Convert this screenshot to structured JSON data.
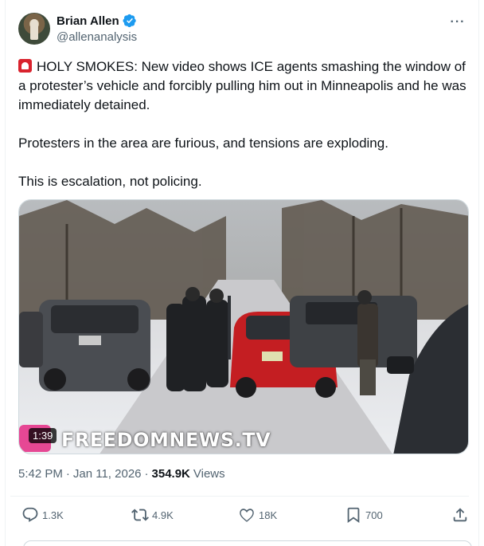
{
  "author": {
    "display_name": "Brian Allen",
    "handle": "@allenanalysis",
    "verified": true
  },
  "tweet": {
    "paragraphs": [
      "HOLY SMOKES: New video shows ICE agents smashing the window of a protester’s vehicle and forcibly pulling him out in Minneapolis and he was immediately detained.",
      "Protesters in the area are furious, and tensions are exploding.",
      "This is escalation, not policing."
    ],
    "emoji_icon": "rotating-light-icon"
  },
  "media": {
    "duration": "1:39",
    "watermark": "FREEDOMNEWS.TV"
  },
  "meta": {
    "time": "5:42 PM",
    "separator": "·",
    "date": "Jan 11, 2026",
    "views_count": "354.9K",
    "views_label": "Views"
  },
  "actions": {
    "replies": "1.3K",
    "reposts": "4.9K",
    "likes": "18K",
    "bookmarks": "700"
  },
  "colors": {
    "text": "#0f1419",
    "secondary": "#536471",
    "verified_blue": "#1d9bf0",
    "border": "#eff3f4"
  }
}
